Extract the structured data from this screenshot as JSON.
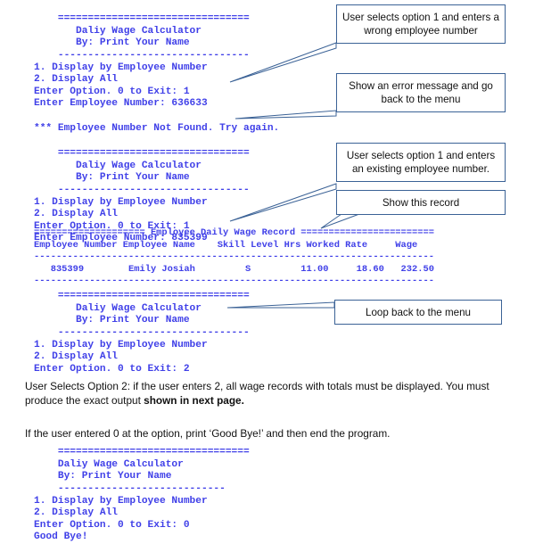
{
  "colors": {
    "console_text": "#4040E8",
    "callout_border": "#3B6296",
    "leader_line": "#3B6296",
    "body_text": "#111111",
    "page_background": "#ffffff"
  },
  "console_blocks": {
    "block1": {
      "lines": [
        "    ================================",
        "       Daliy Wage Calculator",
        "       By: Print Your Name",
        "    --------------------------------",
        "1. Display by Employee Number",
        "2. Display All",
        "Enter Option. 0 to Exit: 1",
        "Enter Employee Number: 636633",
        "",
        "*** Employee Number Not Found. Try again."
      ]
    },
    "block2": {
      "lines": [
        "    ================================",
        "       Daliy Wage Calculator",
        "       By: Print Your Name",
        "    --------------------------------",
        "1. Display by Employee Number",
        "2. Display All",
        "Enter Option. 0 to Exit: 1",
        "Enter Employee Number: 835399"
      ]
    },
    "record_table": {
      "banner": "==================== Employee Daily Wage Record ========================",
      "header": "Employee Number Employee Name    Skill Level Hrs Worked Rate     Wage",
      "rule_top": "------------------------------------------------------------------------",
      "row": "   835399        Emily Josiah         S         11.00     18.60   232.50",
      "rule_bottom": "------------------------------------------------------------------------"
    },
    "block3": {
      "lines": [
        "    ================================",
        "       Daliy Wage Calculator",
        "       By: Print Your Name",
        "    --------------------------------",
        "1. Display by Employee Number",
        "2. Display All",
        "Enter Option. 0 to Exit: 2"
      ]
    },
    "block4": {
      "lines": [
        "    ================================",
        "    Daliy Wage Calculator",
        "    By: Print Your Name",
        "    ----------------------------",
        "1. Display by Employee Number",
        "2. Display All",
        "Enter Option. 0 to Exit: 0",
        "Good Bye!"
      ]
    }
  },
  "record_fields": {
    "employee_number": "835399",
    "employee_name": "Emily Josiah",
    "skill_level": "S",
    "hrs_worked": "11.00",
    "rate": "18.60",
    "wage": "232.50"
  },
  "callouts": [
    {
      "id": "callout-wrong-employee",
      "line1": "User selects option 1 and enters a",
      "line2": "wrong employee number",
      "text": "User selects option 1 and enters a wrong employee number"
    },
    {
      "id": "callout-error-message",
      "line1": "Show an error message and go",
      "line2": "back to the menu",
      "text": "Show an error message and go back to the menu"
    },
    {
      "id": "callout-existing-employee",
      "line1": "User selects option 1 and enters",
      "line2": "an existing employee number.",
      "text": "User selects option 1 and enters an existing employee number."
    },
    {
      "id": "callout-show-record",
      "text": "Show this record"
    },
    {
      "id": "callout-loop-back",
      "text": "Loop back to the menu"
    }
  ],
  "paragraphs": {
    "option2_prefix": "User Selects Option 2: if the user enters 2, all wage records with totals must be displayed. You must produce the exact output ",
    "option2_bold": "shown in next page.",
    "exit_note": "If the user entered 0 at the option, print ‘Good Bye!’ and then end the program."
  }
}
